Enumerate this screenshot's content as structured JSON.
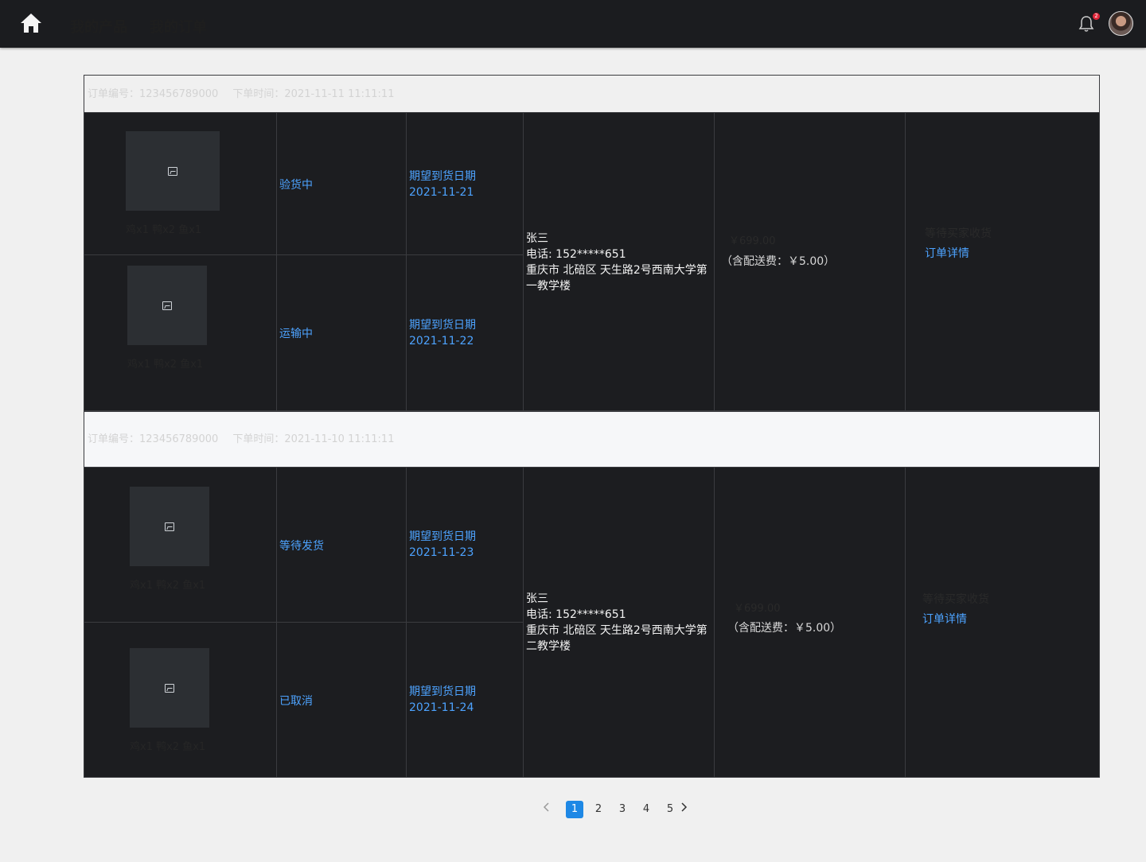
{
  "nav": {
    "home_icon": "home-icon",
    "items": [
      "我的产品",
      "我的订单"
    ],
    "notification_count": "2",
    "bell_icon": "bell-icon",
    "avatar": "user-avatar"
  },
  "orders": [
    {
      "header": {
        "order_no": "订单编号：123456789000",
        "order_time": "下单时间：2021-11-11 11:11:11"
      },
      "products": [
        {
          "items": "鸡x1 鸭x2 鱼x1",
          "status": "验货中",
          "deliver_label": "期望到货日期",
          "deliver_date": "2021-11-21"
        },
        {
          "items": "鸡x1 鸭x2 鱼x1",
          "status": "运输中",
          "deliver_label": "期望到货日期",
          "deliver_date": "2021-11-22"
        }
      ],
      "recipient": {
        "name": "张三",
        "phone": "电话: 152*****651",
        "address": "重庆市 北碚区 天生路2号西南大学第一教学楼"
      },
      "price": "￥699.00",
      "shipping": "（含配送费：￥5.00）",
      "state": "等待买家收货",
      "detail_link": "订单详情"
    },
    {
      "header": {
        "order_no": "订单编号：123456789000",
        "order_time": "下单时间：2021-11-10 11:11:11"
      },
      "products": [
        {
          "items": "鸡x1 鸭x2 鱼x1",
          "status": "等待发货",
          "deliver_label": "期望到货日期",
          "deliver_date": "2021-11-23"
        },
        {
          "items": "鸡x1 鸭x2 鱼x1",
          "status": "已取消",
          "deliver_label": "期望到货日期",
          "deliver_date": "2021-11-24"
        }
      ],
      "recipient": {
        "name": "张三",
        "phone": "电话: 152*****651",
        "address": "重庆市 北碚区 天生路2号西南大学第二教学楼"
      },
      "price": "￥699.00",
      "shipping": "（含配送费：￥5.00）",
      "state": "等待买家收货",
      "detail_link": "订单详情"
    }
  ],
  "pagination": {
    "pages": [
      "1",
      "2",
      "3",
      "4",
      "5"
    ],
    "current": "1",
    "prev_icon": "chevron-left-icon",
    "next_icon": "chevron-right-icon"
  }
}
